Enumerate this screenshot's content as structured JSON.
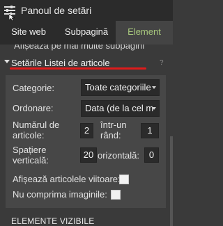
{
  "header": {
    "title": "Panoul de setări"
  },
  "tabs": [
    {
      "label": "Site web"
    },
    {
      "label": "Subpagină"
    },
    {
      "label": "Element"
    }
  ],
  "collapsed_row": {
    "label": "Afișează pe mai multe subpagini"
  },
  "section": {
    "label": "Setările Listei de articole",
    "help": "?"
  },
  "form": {
    "category_label": "Categorie:",
    "category_value": "Toate categoriile",
    "order_label": "Ordonare:",
    "order_value": "Data (de la cel m",
    "count_label_1": "Numărul de",
    "count_label_2": "articole:",
    "count_value": "2",
    "per_row_label_1": "într-un",
    "per_row_label_2": "rând:",
    "per_row_value": "1",
    "vspacing_label_1": "Spațiere",
    "vspacing_label_2": "verticală:",
    "vspacing_value": "20",
    "hspacing_label": "orizontală:",
    "hspacing_value": "0",
    "future_label": "Afișează articolele viitoare:",
    "compress_label": "Nu comprima imaginile:"
  },
  "footer": {
    "title": "ELEMENTE VIZIBILE"
  }
}
